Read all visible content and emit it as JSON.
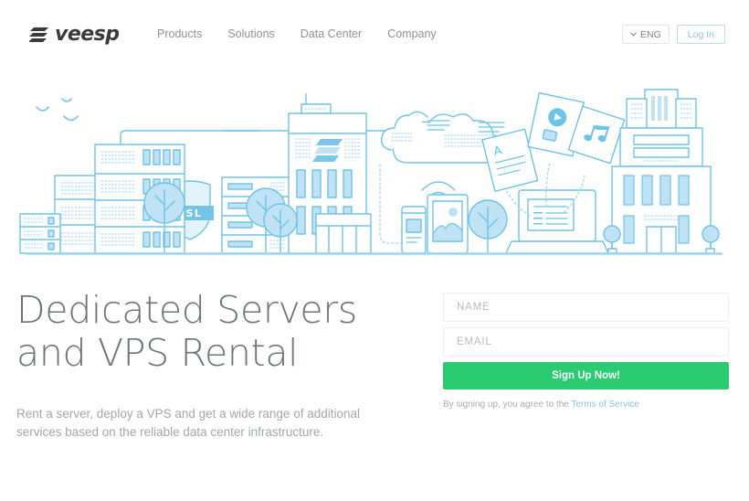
{
  "header": {
    "logo_text": "veesp",
    "logo_icon": "veesp-bars-logo",
    "nav": [
      {
        "label": "Products"
      },
      {
        "label": "Solutions"
      },
      {
        "label": "Data Center"
      },
      {
        "label": "Company"
      }
    ],
    "lang_label": "ENG",
    "lang_icon": "chevron-down-icon",
    "login_label": "Log In"
  },
  "hero": {
    "illustration_name": "data-center-city-illustration",
    "ssl_badge": "SSL",
    "accent_line": "#6ec3e8",
    "accent_fill": "#bfe3f5",
    "document_letter": "A"
  },
  "main": {
    "headline_line1": "Dedicated Servers",
    "headline_line2": "and VPS Rental",
    "subtext_line1": "Rent a server, deploy a VPS and get a wide range of additional",
    "subtext_line2": "services based on the reliable data center infrastructure."
  },
  "signup": {
    "name_placeholder": "NAME",
    "name_value": "",
    "email_placeholder": "EMAIL",
    "email_value": "",
    "button_label": "Sign Up Now!",
    "terms_prefix": "By signing up, you agree to the ",
    "terms_link": "Terms of Service"
  },
  "colors": {
    "brand_green": "#2bcb72",
    "link_blue": "#8cc3e4",
    "illustration_stroke": "#6ec3e8",
    "illustration_fill": "#bfe3f5",
    "text_gray": "#6e7478",
    "muted_gray": "#a3a7ab"
  }
}
